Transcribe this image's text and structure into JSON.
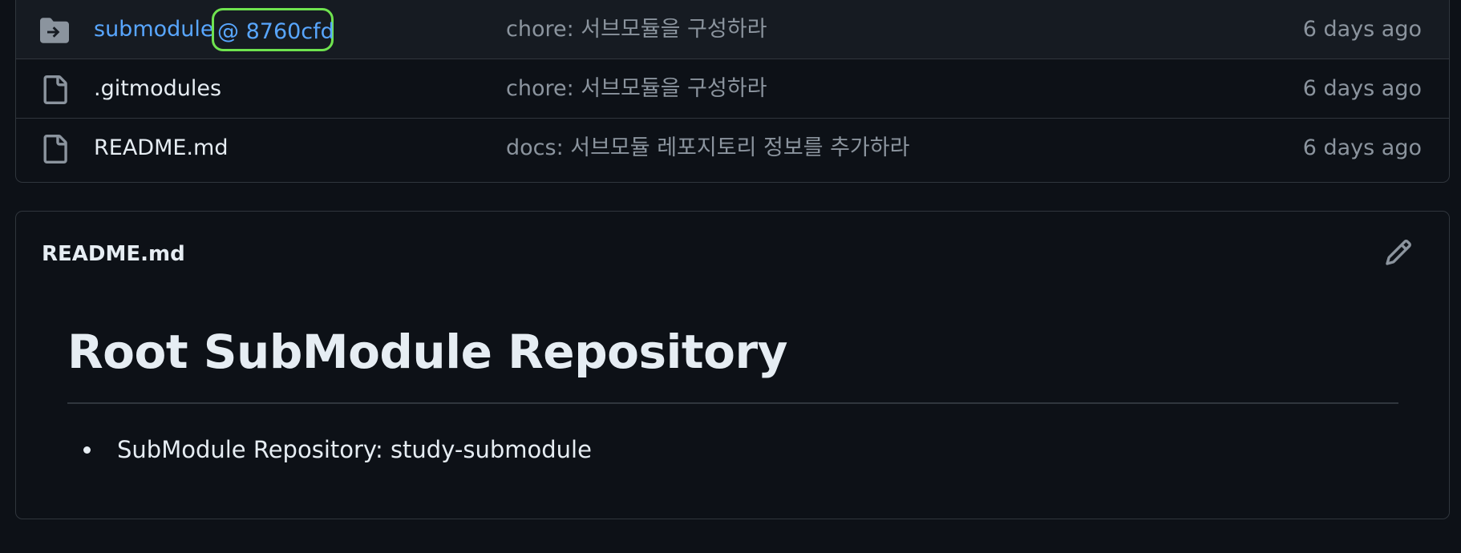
{
  "files": [
    {
      "name": "submodule",
      "ref": "@ 8760cfd",
      "icon": "submodule-folder-icon",
      "message": "chore: 서브모듈을 구성하라",
      "age": "6 days ago"
    },
    {
      "name": ".gitmodules",
      "icon": "file-icon",
      "message": "chore: 서브모듈을 구성하라",
      "age": "6 days ago"
    },
    {
      "name": "README.md",
      "icon": "file-icon",
      "message": "docs: 서브모듈 레포지토리 정보를 추가하라",
      "age": "6 days ago"
    }
  ],
  "readme": {
    "filename": "README.md",
    "edit_icon": "pencil-icon",
    "title": "Root SubModule Repository",
    "items": [
      "SubModule Repository: study-submodule"
    ]
  },
  "colors": {
    "background": "#0d1117",
    "border": "#30363d",
    "link": "#58a6ff",
    "text": "#e6edf3",
    "muted": "#8b949e",
    "highlight": "#6fe34f"
  }
}
